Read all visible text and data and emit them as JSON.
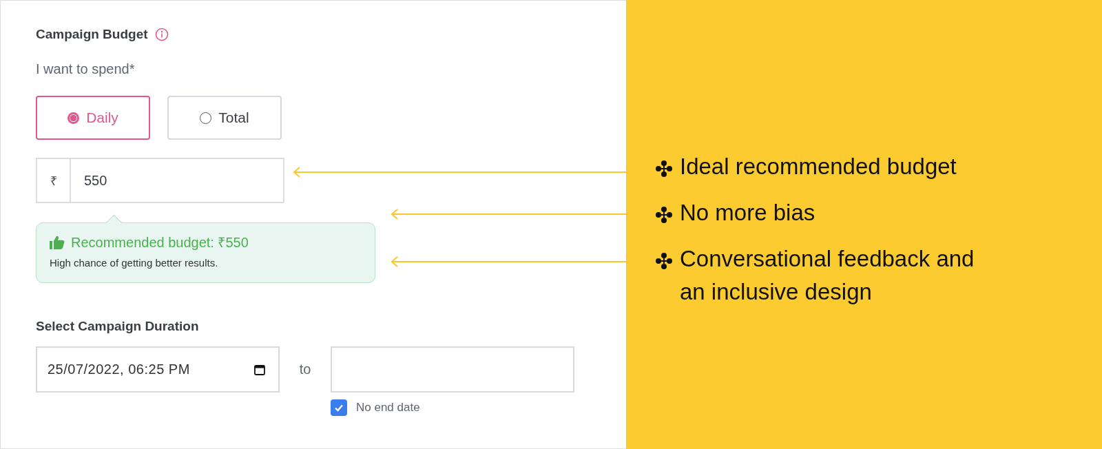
{
  "budget": {
    "title": "Campaign Budget",
    "subtitle": "I want to spend*",
    "options": [
      {
        "label": "Daily",
        "selected": true
      },
      {
        "label": "Total",
        "selected": false
      }
    ],
    "amount": {
      "currency": "₹",
      "value": "550"
    },
    "recommendation": {
      "title": "Recommended budget: ₹550",
      "note": "High chance of getting better results."
    }
  },
  "duration": {
    "title": "Select Campaign Duration",
    "start": "25/07/2022, 06:25 PM",
    "separator": "to",
    "no_end_date": {
      "label": "No end date",
      "checked": true
    }
  },
  "highlights": [
    {
      "text": "Ideal recommended budget"
    },
    {
      "text": "No more bias"
    },
    {
      "text": "Conversational feedback and an inclusive design"
    }
  ]
}
